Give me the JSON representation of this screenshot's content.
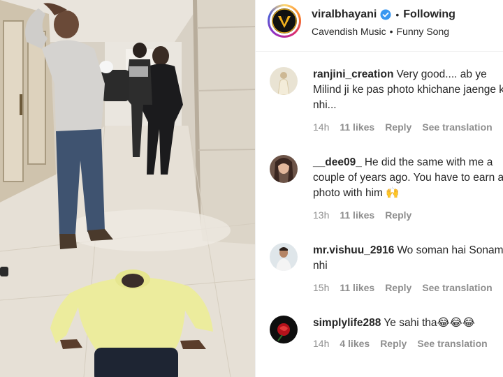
{
  "post": {
    "username": "viralbhayani",
    "separator": "•",
    "follow_status": "Following",
    "audio_artist": "Cavendish Music",
    "audio_sep": "•",
    "audio_track": "Funny Song",
    "verified_icon": "verified-badge-icon",
    "verified_color": "#3897f0"
  },
  "comments": [
    {
      "username": "ranjini_creation",
      "text": "Very good.... ab ye Milind ji ke pas photo khichane jaenge ki nhi...",
      "time": "14h",
      "likes": "11 likes",
      "reply": "Reply",
      "translate": "See translation"
    },
    {
      "username": "__dee09_",
      "text": "He did the same with me a couple of years ago. You have to earn a photo with him 🙌",
      "time": "13h",
      "likes": "11 likes",
      "reply": "Reply",
      "translate": ""
    },
    {
      "username": "mr.vishuu_2916",
      "text": "Wo soman hai Sonam nhi",
      "time": "15h",
      "likes": "11 likes",
      "reply": "Reply",
      "translate": "See translation"
    },
    {
      "username": "simplylife288",
      "text": "Ye sahi tha😂😂😂",
      "time": "14h",
      "likes": "4 likes",
      "reply": "Reply",
      "translate": "See translation"
    }
  ],
  "colors": {
    "text_primary": "#262626",
    "text_secondary": "#8e8e8e",
    "border": "#efefef"
  }
}
